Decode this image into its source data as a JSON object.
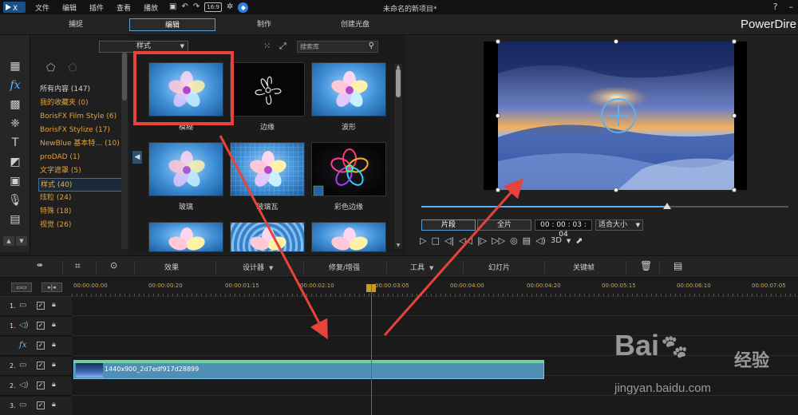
{
  "menu": [
    "文件",
    "编辑",
    "插件",
    "查看",
    "播放"
  ],
  "titlebar": {
    "aspect_badge": "16:9",
    "project_title": "未命名的新项目*",
    "help": "?",
    "minimize": "–"
  },
  "modes": {
    "capture": "捕捉",
    "edit": "编辑",
    "produce": "制作",
    "disc": "创建光盘"
  },
  "brand": "PowerDire",
  "library": {
    "filter_value": "样式",
    "search_placeholder": "搜索库",
    "categories": [
      "所有内容 (147)",
      "我的收藏夹  (0)",
      "BorisFX Film Style  (6)",
      "BorisFX Stylize  (17)",
      "NewBlue 基本特…  (10)",
      "proDAD  (1)",
      "文字遮罩  (5)",
      "样式 (40)",
      "炫粒  (24)",
      "特殊  (18)",
      "视觉  (26)"
    ],
    "thumbnails": [
      {
        "label": "模糊"
      },
      {
        "label": "边缘"
      },
      {
        "label": "波形"
      },
      {
        "label": "玻璃"
      },
      {
        "label": "玻璃瓦"
      },
      {
        "label": "彩色边缘"
      },
      {
        "label": ""
      },
      {
        "label": ""
      },
      {
        "label": ""
      }
    ]
  },
  "preview": {
    "clip_mode": "片段",
    "full_mode": "全片",
    "timecode": "00 : 00 : 03 : 04",
    "fit_label": "适合大小",
    "three_d": "3D",
    "progress": 0.67
  },
  "toolbar": {
    "effects": "效果",
    "designer": "设计器",
    "fix": "修复/增强",
    "tools": "工具",
    "slideshow": "幻灯片",
    "keyframe": "关键帧"
  },
  "ruler": {
    "ticks": [
      "00:00:00:00",
      "00:00:00:20",
      "00:00:01:15",
      "00:00:02:10",
      "00:00:03:05",
      "00:00:04:00",
      "00:00:04:20",
      "00:00:05:15",
      "00:00:06:10",
      "00:00:07:05"
    ]
  },
  "tracks": [
    {
      "num": "1.",
      "type": "video-icon",
      "glyph": "▭"
    },
    {
      "num": "1.",
      "type": "audio-icon",
      "glyph": "◁)"
    },
    {
      "num": "",
      "type": "fx-icon",
      "glyph": "fx"
    },
    {
      "num": "2.",
      "type": "video-icon",
      "glyph": "▭"
    },
    {
      "num": "2.",
      "type": "audio-icon",
      "glyph": "◁)"
    },
    {
      "num": "3.",
      "type": "video-icon",
      "glyph": "▭"
    }
  ],
  "clip": {
    "name": "1440x900_2d7edf917d28899"
  },
  "watermark": {
    "brand": "Bai",
    "suffix": "经验",
    "url": "jingyan.baidu.com"
  },
  "colors": {
    "accent": "#5a9fd4",
    "category": "#e2a33a",
    "highlight": "#e8433a",
    "clip": "#4f8fb5"
  }
}
